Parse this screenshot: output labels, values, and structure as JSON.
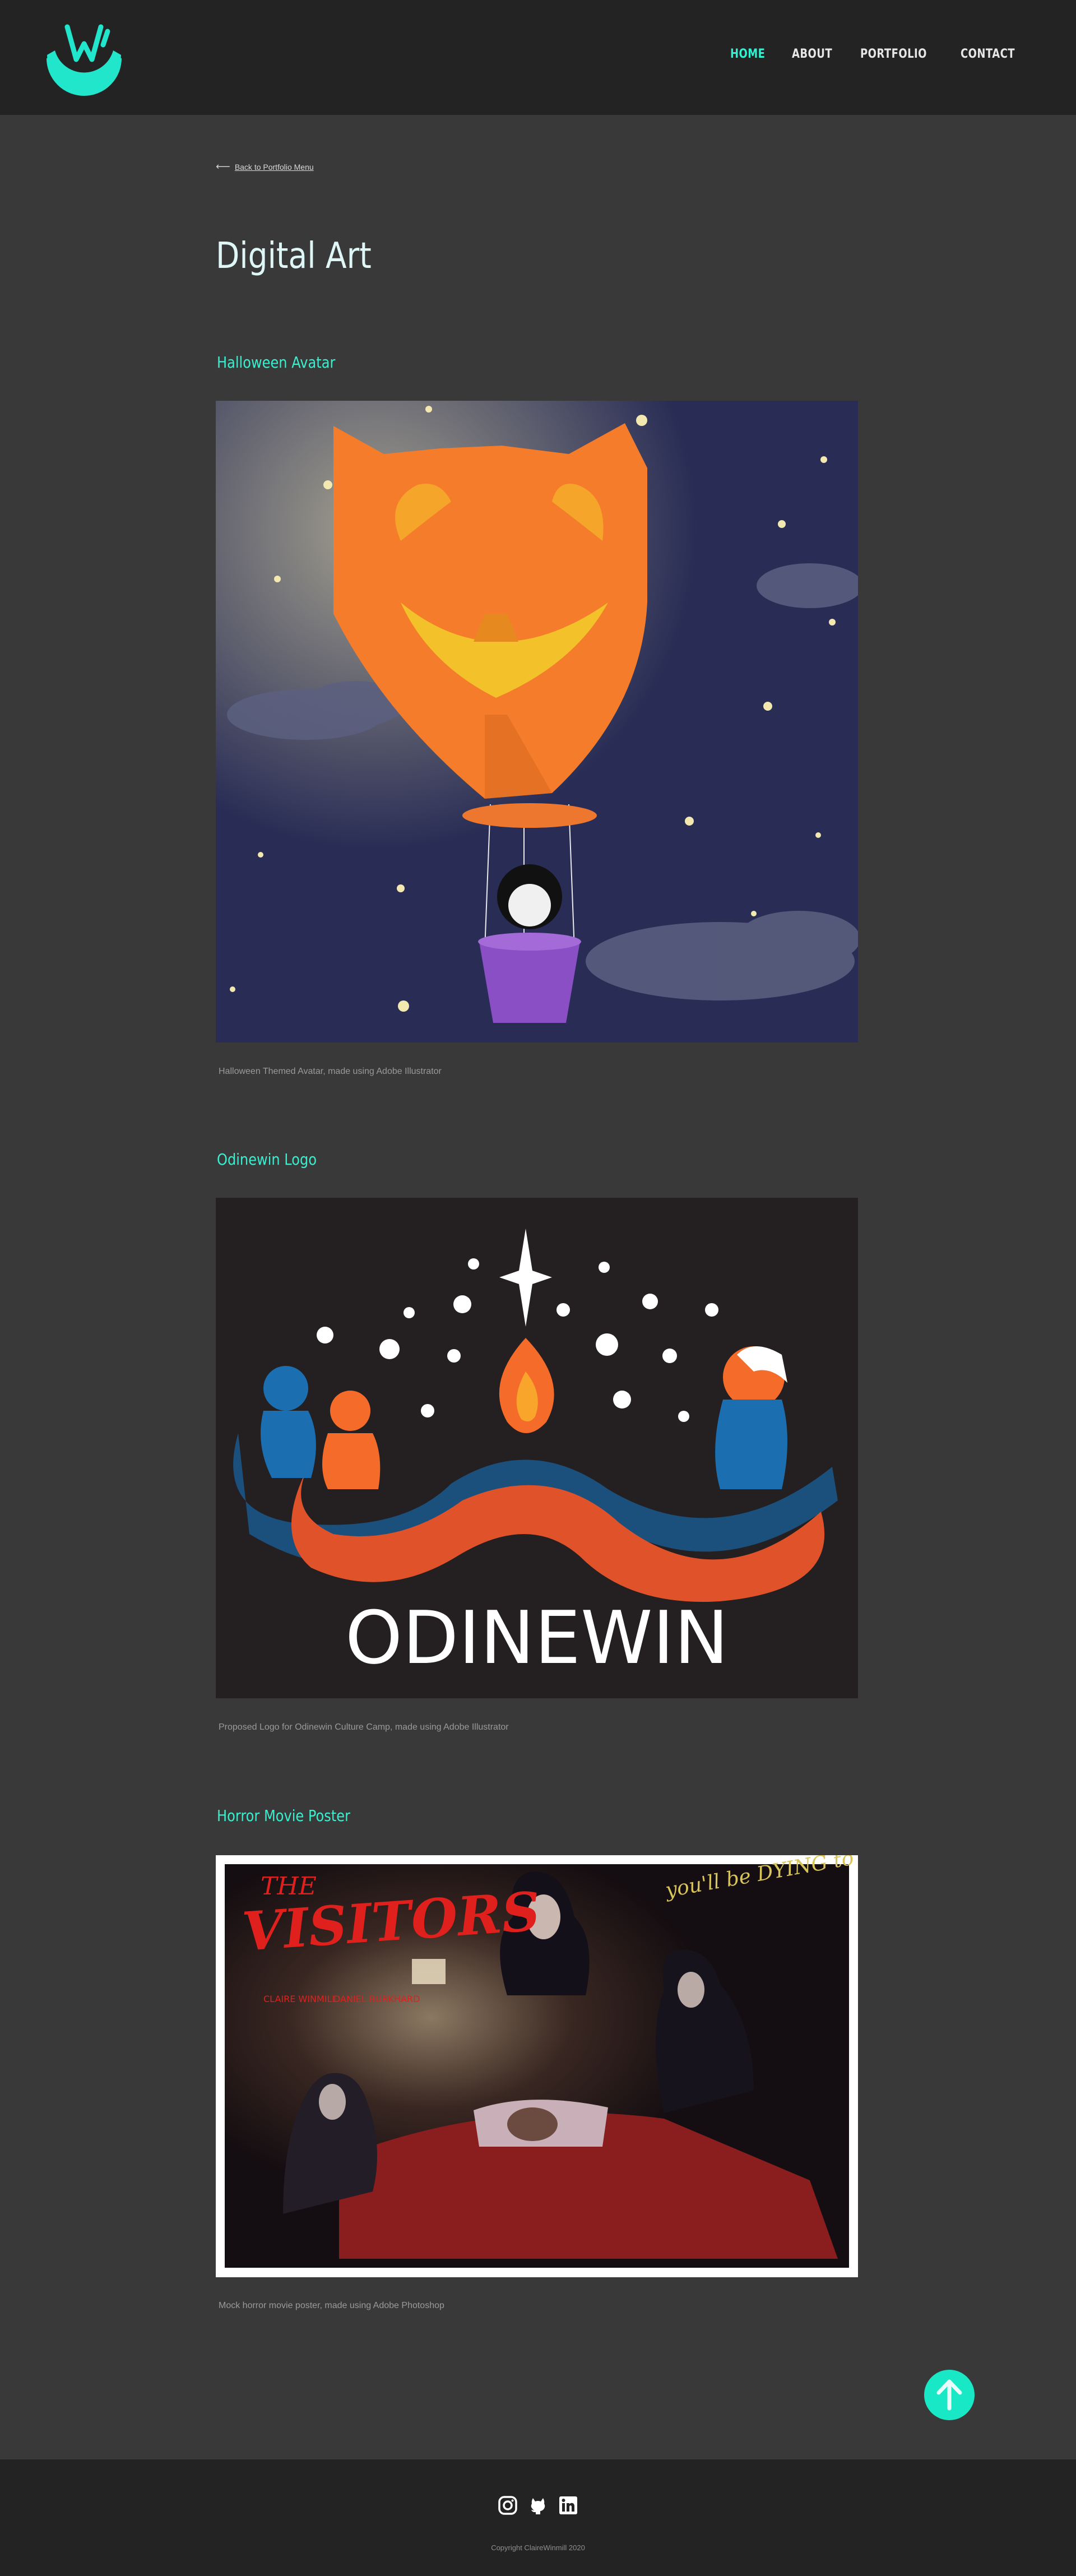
{
  "nav": {
    "home": "HOME",
    "about": "ABOUT",
    "portfolio": "PORTFOLIO",
    "contact": "CONTACT"
  },
  "back_link": "Back to Portfolio Menu",
  "page_title": "Digital Art",
  "works": [
    {
      "title": "Halloween Avatar",
      "caption": "Halloween Themed Avatar,  made using Adobe Illustrator"
    },
    {
      "title": "Odinewin Logo",
      "caption": "Proposed Logo for Odinewin Culture Camp, made using Adobe Illustrator",
      "logo_text": "ODINEWIN"
    },
    {
      "title": "Horror Movie Poster",
      "caption": "Mock horror movie poster,  made using Adobe Photoshop",
      "poster_title": "THE VISITORS",
      "poster_actors": [
        "CLAIRE WINMILL",
        "DANIEL BURKHARD"
      ],
      "poster_tagline": "you'll be DYING to let them in"
    }
  ],
  "footer": {
    "copyright": "Copyright ClaireWinmill 2020"
  },
  "colors": {
    "accent": "#30f2d2",
    "background": "#393939",
    "header": "#232323"
  },
  "icons": [
    "logo-w-icon",
    "arrow-left-icon",
    "arrow-up-icon",
    "instagram-icon",
    "github-icon",
    "linkedin-icon"
  ]
}
